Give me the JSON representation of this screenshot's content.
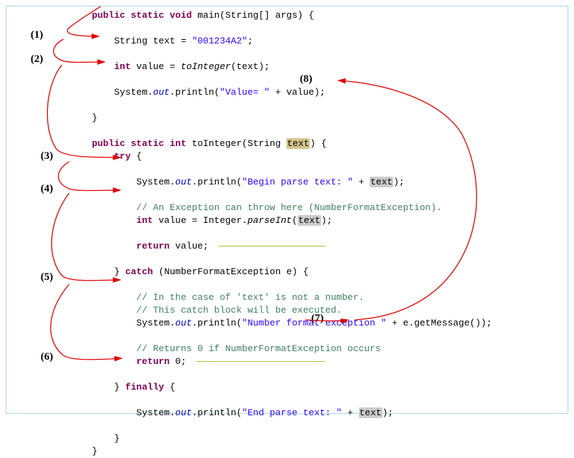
{
  "steps": {
    "s1": "(1)",
    "s2": "(2)",
    "s3": "(3)",
    "s4": "(4)",
    "s5": "(5)",
    "s6": "(6)",
    "s7": "(7)",
    "s8": "(8)"
  },
  "code": {
    "l1_kw1": "public static void",
    "l1_name": " main(String[] args) {",
    "l2_decl": "String text = ",
    "l2_str": "\"001234A2\"",
    "l2_end": ";",
    "l3_kw": "int",
    "l3_decl": " value = ",
    "l3_call": "toInteger",
    "l3_rest": "(text);",
    "l4_a": "System.",
    "l4_out": "out",
    "l4_b": ".println(",
    "l4_str": "\"Value= \"",
    "l4_c": " + value);",
    "l5_close": "}",
    "l6_kw": "public static int",
    "l6_rest": " toInteger(String ",
    "l6_param": "text",
    "l6_end": ") {",
    "l7_kw": "try",
    "l7_rest": " {",
    "l8_a": "System.",
    "l8_out": "out",
    "l8_b": ".println(",
    "l8_str": "\"Begin parse text: \"",
    "l8_c": " + ",
    "l8_t": "text",
    "l8_end": ");",
    "l9_comment": "// An Exception can throw here (NumberFormatException).",
    "l10_kw": "int",
    "l10_a": " value = Integer.",
    "l10_call": "parseInt",
    "l10_b": "(",
    "l10_t": "text",
    "l10_end": ");",
    "l11_kw": "return",
    "l11_rest": " value;",
    "l12_close": "} ",
    "l12_kw": "catch",
    "l12_rest": " (NumberFormatException e) {",
    "l13_comment": "// In the case of 'text' is not a number.",
    "l14_comment": "// This catch block will be executed.",
    "l15_a": "System.",
    "l15_out": "out",
    "l15_b": ".println(",
    "l15_str": "\"Number format exception \"",
    "l15_c": " + e.getMessage());",
    "l16_comment": "// Returns 0 if NumberFormatException occurs",
    "l17_kw": "return",
    "l17_rest": " 0;",
    "l18_close": "} ",
    "l18_kw": "finally",
    "l18_rest": " {",
    "l19_a": "System.",
    "l19_out": "out",
    "l19_b": ".println(",
    "l19_str": "\"End parse text: \"",
    "l19_c": " + ",
    "l19_t": "text",
    "l19_end": ");",
    "l20_close": "}",
    "l21_close": "}"
  },
  "flow": {
    "description": "Execution flow annotations showing try-catch-finally control flow with NumberFormatException handling",
    "arrows": [
      {
        "from": "top",
        "to": "step1",
        "label": "(1)"
      },
      {
        "from": "step1",
        "to": "step2",
        "label": "(2)"
      },
      {
        "from": "step2",
        "to": "step3",
        "label": "(3)"
      },
      {
        "from": "step3",
        "to": "step4",
        "label": "(4)"
      },
      {
        "from": "step4",
        "to": "step5",
        "label": "(5)"
      },
      {
        "from": "step5",
        "to": "step6",
        "label": "(6)"
      },
      {
        "from": "return0",
        "to": "step7",
        "label": "(7)"
      },
      {
        "from": "step7",
        "to": "step8",
        "label": "(8)"
      }
    ]
  }
}
